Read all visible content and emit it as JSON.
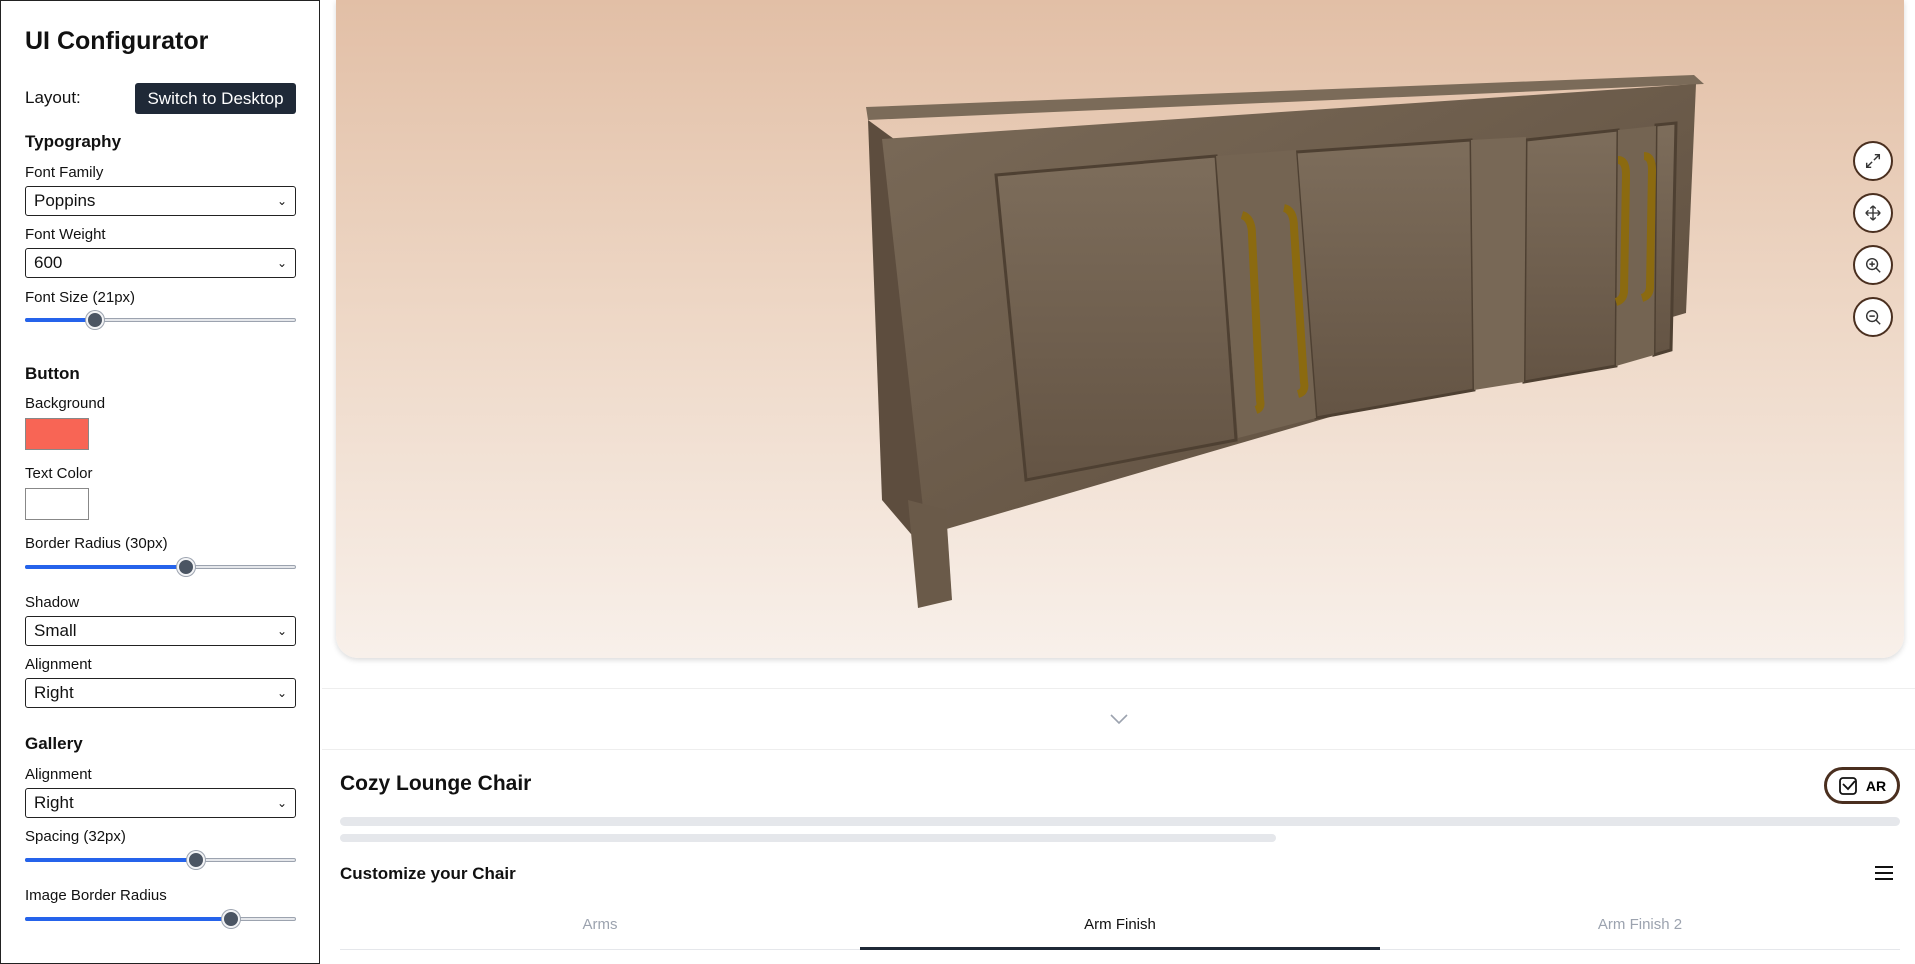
{
  "sidebar": {
    "title": "UI Configurator",
    "layout_label": "Layout:",
    "layout_button": "Switch to Desktop",
    "typography": {
      "heading": "Typography",
      "font_family_label": "Font Family",
      "font_family_value": "Poppins",
      "font_weight_label": "Font Weight",
      "font_weight_value": "600",
      "font_size_label": "Font Size (21px)",
      "font_size_fraction": 0.24
    },
    "button": {
      "heading": "Button",
      "background_label": "Background",
      "background_color": "#f86555",
      "text_color_label": "Text Color",
      "text_color": "#ffffff",
      "border_radius_label": "Border Radius (30px)",
      "border_radius_fraction": 0.6,
      "shadow_label": "Shadow",
      "shadow_value": "Small",
      "alignment_label": "Alignment",
      "alignment_value": "Right"
    },
    "gallery": {
      "heading": "Gallery",
      "alignment_label": "Alignment",
      "alignment_value": "Right",
      "spacing_label": "Spacing (32px)",
      "spacing_fraction": 0.64,
      "image_radius_label": "Image Border Radius",
      "image_radius_fraction": 0.78
    }
  },
  "viewer": {
    "controls": [
      "expand-icon",
      "move-icon",
      "zoom-in-icon",
      "zoom-out-icon"
    ]
  },
  "product": {
    "title": "Cozy Lounge Chair",
    "ar_label": "AR",
    "customize_title": "Customize your Chair",
    "tabs": [
      {
        "label": "Arms",
        "active": false
      },
      {
        "label": "Arm Finish",
        "active": true
      },
      {
        "label": "Arm Finish 2",
        "active": false
      }
    ]
  },
  "colors": {
    "accent": "#2563eb",
    "dark_button": "#1f2937",
    "control_border": "#4a2f1f"
  }
}
